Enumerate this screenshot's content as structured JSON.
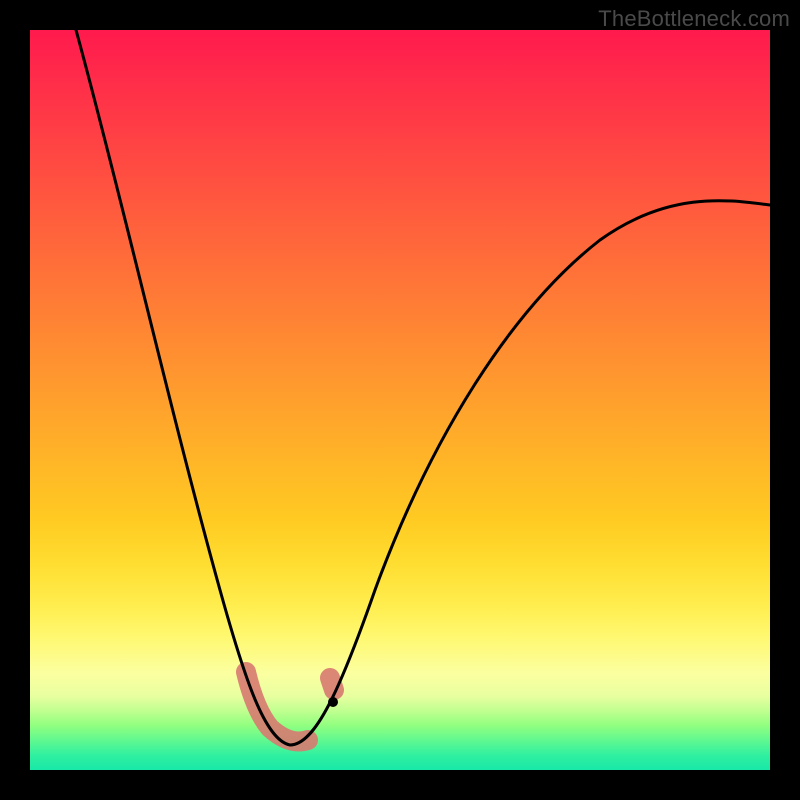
{
  "watermark": "TheBottleneck.com",
  "colors": {
    "gradient_top": "#ff1a4d",
    "gradient_mid": "#ffdd30",
    "gradient_bottom": "#18e8a8",
    "curve": "#000000",
    "smear": "#d77a70",
    "background": "#000000"
  },
  "chart_data": {
    "type": "line",
    "title": "",
    "xlabel": "",
    "ylabel": "",
    "xlim": [
      0,
      100
    ],
    "ylim": [
      0,
      100
    ],
    "note": "Axes are unlabeled in the source image; x and y are normalized 0–100 estimates read from pixel positions. y=0 corresponds to the bottom (green) edge, y=100 to the top (red) edge.",
    "series": [
      {
        "name": "bottleneck-curve",
        "x": [
          6,
          10,
          15,
          20,
          25,
          28,
          31,
          34,
          36,
          38,
          42,
          48,
          55,
          63,
          72,
          82,
          92,
          100
        ],
        "y": [
          100,
          84,
          66,
          48,
          32,
          20,
          10,
          4,
          3,
          5,
          14,
          28,
          42,
          55,
          65,
          72,
          76,
          77
        ]
      }
    ],
    "annotations": [
      {
        "name": "trough-highlight",
        "type": "smear",
        "x_range": [
          29,
          41
        ],
        "y_range": [
          3,
          14
        ],
        "color": "#d77a70"
      },
      {
        "name": "curve-marker-dot",
        "type": "point",
        "x": 41,
        "y": 9,
        "color": "#000000"
      }
    ],
    "background_gradient": {
      "direction": "vertical",
      "stops": [
        {
          "pos": 0.0,
          "color": "#ff1a4d"
        },
        {
          "pos": 0.5,
          "color": "#ff9a2e"
        },
        {
          "pos": 0.78,
          "color": "#ffee50"
        },
        {
          "pos": 0.9,
          "color": "#e8ffa0"
        },
        {
          "pos": 1.0,
          "color": "#18e8a8"
        }
      ]
    }
  }
}
